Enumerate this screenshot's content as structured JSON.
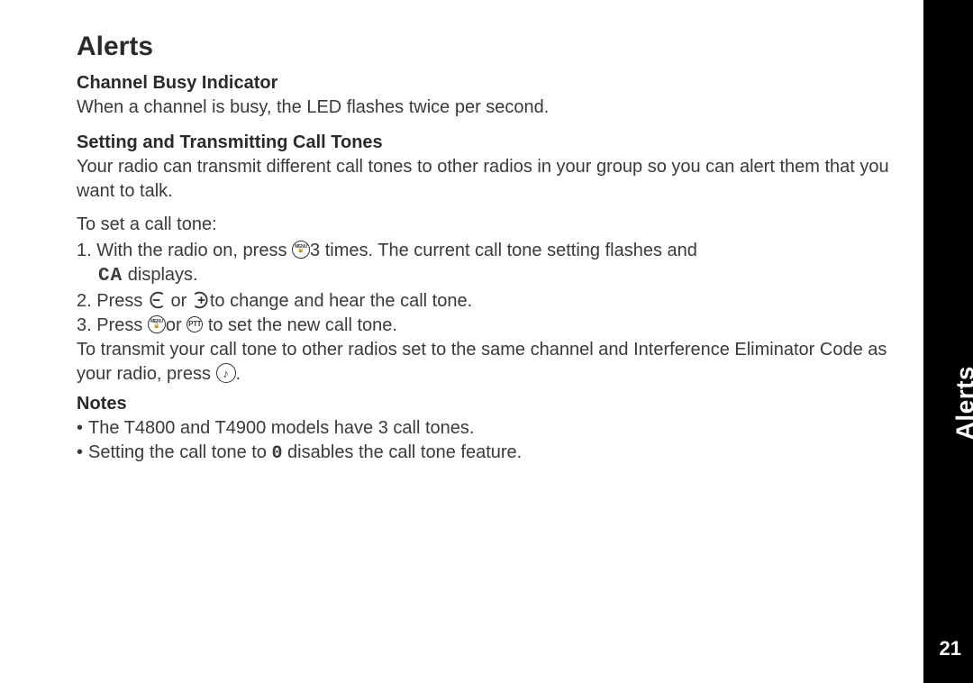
{
  "heading": "Alerts",
  "section1": {
    "title": "Channel Busy Indicator",
    "text": "When a channel is busy, the LED flashes twice per second."
  },
  "section2": {
    "title": "Setting and Transmitting Call Tones",
    "intro": "Your radio can transmit different call tones to other radios in your group so you can alert them that you want to talk.",
    "lead": "To set a call tone:",
    "step1_a": "1. With the radio on, press ",
    "step1_b": "3 times. The current call tone setting flashes and",
    "step1_c": " displays.",
    "step2_a": "2. Press ",
    "step2_b": " or ",
    "step2_c": "to change and hear the call tone.",
    "step3_a": "3. Press ",
    "step3_b": "or ",
    "step3_c": " to set the new call tone.",
    "transmit_a": "To transmit your call tone to other radios set to the same channel and Interference Eliminator Code as your radio, press ",
    "transmit_b": "."
  },
  "section3": {
    "title": "Notes",
    "note1": "The T4800 and T4900 models have 3 call tones.",
    "note2_a": "Setting the call tone to ",
    "note2_b": " disables the call tone feature."
  },
  "icons": {
    "menu": "MENU",
    "lock_glyph": "🔒",
    "ptt": "PTT",
    "ca_chars": "CA",
    "zero_char": "0",
    "note_glyph": "♪"
  },
  "tab": {
    "label": "Alerts",
    "page": "21"
  }
}
